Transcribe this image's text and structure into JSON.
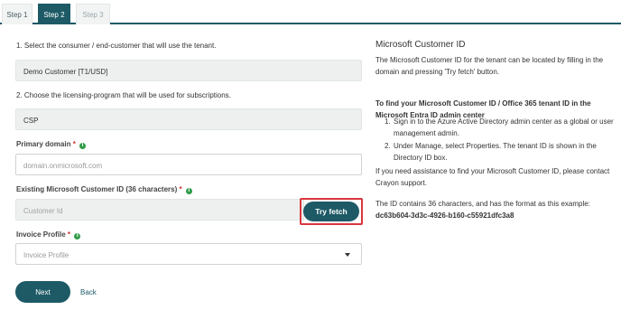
{
  "tabs": [
    {
      "label": "Step 1"
    },
    {
      "label": "Step 2"
    },
    {
      "label": "Step 3"
    }
  ],
  "form": {
    "customer_prompt": "1. Select the consumer / end-customer that will use the tenant.",
    "customer_value": "Demo Customer [T1/USD]",
    "program_prompt": "2. Choose the licensing-program that will be used for subscriptions.",
    "program_value": "CSP",
    "primary_domain_label": "Primary domain",
    "primary_domain_placeholder": "domain.onmicrosoft.com",
    "customer_id_label": "Existing Microsoft Customer ID (36 characters)",
    "customer_id_placeholder": "Customer Id",
    "try_fetch_label": "Try fetch",
    "invoice_profile_label": "Invoice Profile",
    "invoice_profile_value": "Invoice Profile",
    "required_mark": "*",
    "info_glyph": "i",
    "next_label": "Next",
    "back_label": "Back"
  },
  "help": {
    "title": "Microsoft Customer ID",
    "intro": "The Microsoft Customer ID for the tenant can be located by filling in the domain and pressing 'Try fetch' button.",
    "find_heading": "To find your Microsoft Customer ID / Office 365 tenant ID in the Microsoft Entra ID admin center",
    "steps": [
      {
        "num": "1.",
        "text": "Sign in to the Azure Active Directory admin center as a global or user management admin."
      },
      {
        "num": "2.",
        "text": "Under Manage, select Properties. The tenant ID is shown in the Directory ID box."
      }
    ],
    "assistance": "If you need assistance to find your Microsoft Customer ID, please contact Crayon support.",
    "format_text": "The ID contains 36 characters, and has the format as this example: ",
    "example_id": "dc63b604-3d3c-4926-b160-c55921dfc3a8"
  }
}
